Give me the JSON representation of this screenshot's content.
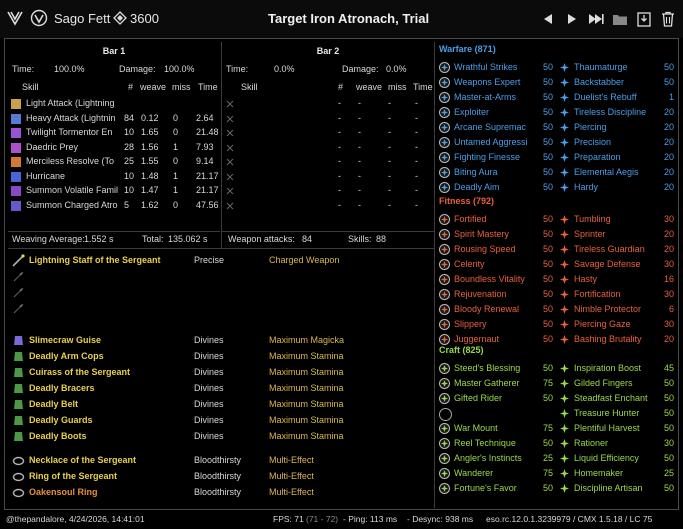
{
  "header": {
    "character": "Sago Fett",
    "cp": "3600",
    "title": "Target Iron Atronach, Trial"
  },
  "bar1": {
    "title": "Bar 1",
    "time_label": "Time:",
    "time_value": "100.0%",
    "damage_label": "Damage:",
    "damage_value": "100.0%",
    "columns": [
      "Skill",
      "#",
      "weave",
      "miss",
      "Time"
    ],
    "rows": [
      {
        "skill": "Light Attack (Lightning",
        "count": "",
        "weave": "",
        "miss": "",
        "time": ""
      },
      {
        "skill": "Heavy Attack (Lightnin",
        "count": "84",
        "weave": "0.12",
        "miss": "0",
        "time": "2.64"
      },
      {
        "skill": "Twilight Tormentor En",
        "count": "10",
        "weave": "1.65",
        "miss": "0",
        "time": "21.48"
      },
      {
        "skill": "Daedric Prey",
        "count": "28",
        "weave": "1.56",
        "miss": "1",
        "time": "7.93"
      },
      {
        "skill": "Merciless Resolve (To",
        "count": "25",
        "weave": "1.55",
        "miss": "0",
        "time": "9.14"
      },
      {
        "skill": "Hurricane",
        "count": "10",
        "weave": "1.48",
        "miss": "1",
        "time": "21.17"
      },
      {
        "skill": "Summon Volatile Famil",
        "count": "10",
        "weave": "1.47",
        "miss": "1",
        "time": "21.17"
      },
      {
        "skill": "Summon Charged Atro",
        "count": "5",
        "weave": "1.62",
        "miss": "0",
        "time": "47.56"
      }
    ],
    "weaving_label": "Weaving Average:",
    "weaving_value": "1.552 s",
    "total_label": "Total:",
    "total_value": "135.062 s"
  },
  "bar2": {
    "title": "Bar 2",
    "time_label": "Time:",
    "time_value": "0.0%",
    "damage_label": "Damage:",
    "damage_value": "0.0%",
    "columns": [
      "Skill",
      "#",
      "weave",
      "miss",
      "Time"
    ],
    "rows": [
      {
        "skill": "",
        "count": "-",
        "weave": "-",
        "miss": "-",
        "time": "-"
      },
      {
        "skill": "",
        "count": "-",
        "weave": "-",
        "miss": "-",
        "time": "-"
      },
      {
        "skill": "",
        "count": "-",
        "weave": "-",
        "miss": "-",
        "time": "-"
      },
      {
        "skill": "",
        "count": "-",
        "weave": "-",
        "miss": "-",
        "time": "-"
      },
      {
        "skill": "",
        "count": "-",
        "weave": "-",
        "miss": "-",
        "time": "-"
      },
      {
        "skill": "",
        "count": "-",
        "weave": "-",
        "miss": "-",
        "time": "-"
      },
      {
        "skill": "",
        "count": "-",
        "weave": "-",
        "miss": "-",
        "time": "-"
      },
      {
        "skill": "",
        "count": "-",
        "weave": "-",
        "miss": "-",
        "time": "-"
      }
    ],
    "weapon_label": "Weapon attacks:",
    "weapon_value": "84",
    "skills_label": "Skills:",
    "skills_value": "88"
  },
  "gear": [
    {
      "name": "Lightning Staff of the Sergeant",
      "trait": "Precise",
      "enchant": "Charged Weapon",
      "color": "yellow",
      "icon": "staff-icon"
    },
    {
      "name": "",
      "trait": "",
      "enchant": "",
      "icon": "empty-slot-icon"
    },
    {
      "name": "",
      "trait": "",
      "enchant": "",
      "icon": "empty-slot-icon"
    },
    {
      "name": "",
      "trait": "",
      "enchant": "",
      "icon": "empty-slot-icon"
    },
    {
      "name": "Slimecraw Guise",
      "trait": "Divines",
      "enchant": "Maximum Magicka",
      "color": "yellow",
      "icon": "helmet-icon"
    },
    {
      "name": "Deadly Arm Cops",
      "trait": "Divines",
      "enchant": "Maximum Stamina",
      "color": "yellow",
      "icon": "shoulders-icon"
    },
    {
      "name": "Cuirass of the Sergeant",
      "trait": "Divines",
      "enchant": "Maximum Stamina",
      "color": "yellow",
      "icon": "chest-icon"
    },
    {
      "name": "Deadly Bracers",
      "trait": "Divines",
      "enchant": "Maximum Stamina",
      "color": "yellow",
      "icon": "gloves-icon"
    },
    {
      "name": "Deadly Belt",
      "trait": "Divines",
      "enchant": "Maximum Stamina",
      "color": "yellow",
      "icon": "belt-icon"
    },
    {
      "name": "Deadly Guards",
      "trait": "Divines",
      "enchant": "Maximum Stamina",
      "color": "yellow",
      "icon": "legs-icon"
    },
    {
      "name": "Deadly Boots",
      "trait": "Divines",
      "enchant": "Maximum Stamina",
      "color": "yellow",
      "icon": "boots-icon"
    },
    {
      "name": "Necklace of the Sergeant",
      "trait": "Bloodthirsty",
      "enchant": "Multi-Effect",
      "color": "yellow",
      "icon": "necklace-icon"
    },
    {
      "name": "Ring of the Sergeant",
      "trait": "Bloodthirsty",
      "enchant": "Multi-Effect",
      "color": "yellow",
      "icon": "ring-icon"
    },
    {
      "name": "Oakensoul Ring",
      "trait": "Bloodthirsty",
      "enchant": "Multi-Effect",
      "color": "orange",
      "icon": "ring-icon"
    }
  ],
  "cp": {
    "warfare": {
      "label": "Warfare (871)",
      "color": "#4a9ee8",
      "left": [
        {
          "name": "Wrathful Strikes",
          "value": "50"
        },
        {
          "name": "Weapons Expert",
          "value": "50"
        },
        {
          "name": "Master-at-Arms",
          "value": "50"
        },
        {
          "name": "Exploiter",
          "value": "50"
        },
        {
          "name": "Arcane Supremac",
          "value": "50"
        },
        {
          "name": "Untamed Aggressi",
          "value": "50"
        },
        {
          "name": "Fighting Finesse",
          "value": "50"
        },
        {
          "name": "Biting Aura",
          "value": "50"
        },
        {
          "name": "Deadly Aim",
          "value": "50"
        }
      ],
      "right": [
        {
          "name": "Thaumaturge",
          "value": "50"
        },
        {
          "name": "Backstabber",
          "value": "50"
        },
        {
          "name": "Duelist's Rebuff",
          "value": "1"
        },
        {
          "name": "Tireless Discipline",
          "value": "20"
        },
        {
          "name": "Piercing",
          "value": "20"
        },
        {
          "name": "Precision",
          "value": "20"
        },
        {
          "name": "Preparation",
          "value": "20"
        },
        {
          "name": "Elemental Aegis",
          "value": "20"
        },
        {
          "name": "Hardy",
          "value": "20"
        }
      ]
    },
    "fitness": {
      "label": "Fitness (792)",
      "color": "#e8603a",
      "left": [
        {
          "name": "Fortified",
          "value": "50"
        },
        {
          "name": "Spirit Mastery",
          "value": "50"
        },
        {
          "name": "Rousing Speed",
          "value": "50"
        },
        {
          "name": "Celerity",
          "value": "50"
        },
        {
          "name": "Boundless Vitality",
          "value": "50"
        },
        {
          "name": "Rejuvenation",
          "value": "50"
        },
        {
          "name": "Bloody Renewal",
          "value": "50"
        },
        {
          "name": "Slippery",
          "value": "50"
        },
        {
          "name": "Juggernaut",
          "value": "50"
        }
      ],
      "right": [
        {
          "name": "Tumbling",
          "value": "30"
        },
        {
          "name": "Sprinter",
          "value": "20"
        },
        {
          "name": "Tireless Guardian",
          "value": "20"
        },
        {
          "name": "Savage Defense",
          "value": "30"
        },
        {
          "name": "Hasty",
          "value": "16"
        },
        {
          "name": "Fortification",
          "value": "30"
        },
        {
          "name": "Nimble Protector",
          "value": "6"
        },
        {
          "name": "Piercing Gaze",
          "value": "30"
        },
        {
          "name": "Bashing Brutality",
          "value": "20"
        }
      ]
    },
    "craft": {
      "label": "Craft (825)",
      "color": "#9ad84a",
      "left": [
        {
          "name": "Steed's Blessing",
          "value": "50"
        },
        {
          "name": "Master Gatherer",
          "value": "75"
        },
        {
          "name": "Gifted Rider",
          "value": "50"
        },
        {
          "name": "",
          "value": ""
        },
        {
          "name": "War Mount",
          "value": "75"
        },
        {
          "name": "Reel Technique",
          "value": "50"
        },
        {
          "name": "Angler's Instincts",
          "value": "25"
        },
        {
          "name": "Wanderer",
          "value": "75"
        },
        {
          "name": "Fortune's Favor",
          "value": "50"
        }
      ],
      "right": [
        {
          "name": "Inspiration Boost",
          "value": "45"
        },
        {
          "name": "Gilded Fingers",
          "value": "50"
        },
        {
          "name": "Steadfast Enchant",
          "value": "50"
        },
        {
          "name": "Treasure Hunter",
          "value": "50"
        },
        {
          "name": "Plentiful Harvest",
          "value": "50"
        },
        {
          "name": "Rationer",
          "value": "30"
        },
        {
          "name": "Liquid Efficiency",
          "value": "50"
        },
        {
          "name": "Homemaker",
          "value": "25"
        },
        {
          "name": "Discipline Artisan",
          "value": "50"
        }
      ]
    }
  },
  "status": {
    "user_date": "@thepandalore, 4/24/2026, 14:41:01",
    "fps_label": "FPS: 71",
    "fps_range": "(71 - 72)",
    "ping": "- Ping: 113 ms",
    "desync": "- Desync: 938 ms",
    "version": "eso.rc.12.0.1.3239979 / CMX 1.5.18 / LC 75"
  }
}
